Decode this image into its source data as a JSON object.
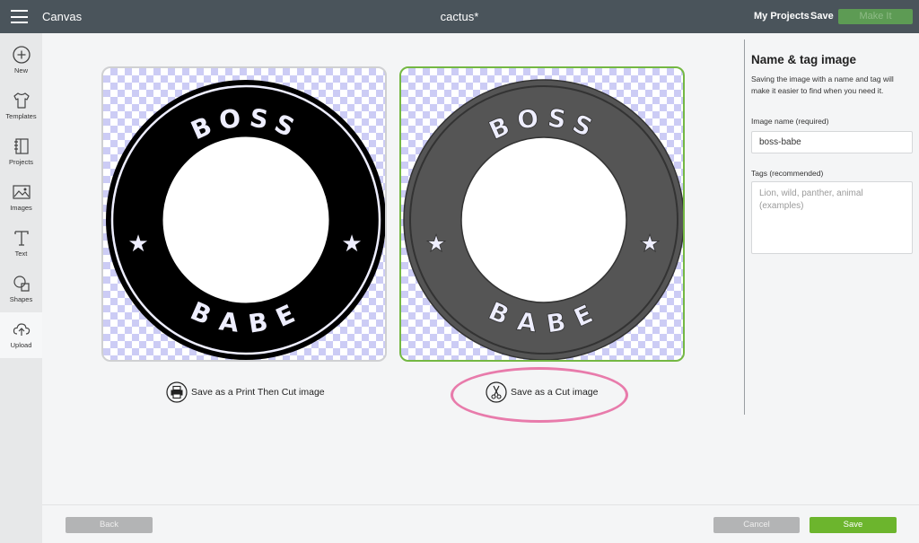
{
  "header": {
    "app_name": "Canvas",
    "document_title": "cactus*",
    "my_projects_label": "My Projects",
    "save_label": "Save",
    "make_it_label": "Make It"
  },
  "sidebar": {
    "items": [
      {
        "label": "New",
        "icon": "plus-circle-icon"
      },
      {
        "label": "Templates",
        "icon": "tshirt-icon"
      },
      {
        "label": "Projects",
        "icon": "notebook-icon"
      },
      {
        "label": "Images",
        "icon": "image-icon"
      },
      {
        "label": "Text",
        "icon": "text-t-icon"
      },
      {
        "label": "Shapes",
        "icon": "shapes-icon"
      },
      {
        "label": "Upload",
        "icon": "cloud-upload-icon"
      }
    ],
    "active": "Upload"
  },
  "preview": {
    "top_word": "BOSS",
    "bottom_word": "BABE",
    "print_cut_label": "Save as a Print Then Cut image",
    "cut_label": "Save as a Cut image",
    "selected": "cut"
  },
  "panel": {
    "title": "Name & tag image",
    "description": "Saving the image with a name and tag will make it easier to find when you need it.",
    "name_label": "Image name (required)",
    "name_value": "boss-babe",
    "tags_label": "Tags (recommended)",
    "tags_placeholder": "Lion, wild, panther, animal (examples)"
  },
  "footer": {
    "back_label": "Back",
    "cancel_label": "Cancel",
    "save_label": "Save"
  },
  "colors": {
    "topbar": "#4a545b",
    "accent_green": "#6cb52d",
    "selected_border": "#74b843",
    "highlight_pink": "#e87bab",
    "print_badge_fill": "#000000",
    "cut_badge_fill": "#555555"
  }
}
